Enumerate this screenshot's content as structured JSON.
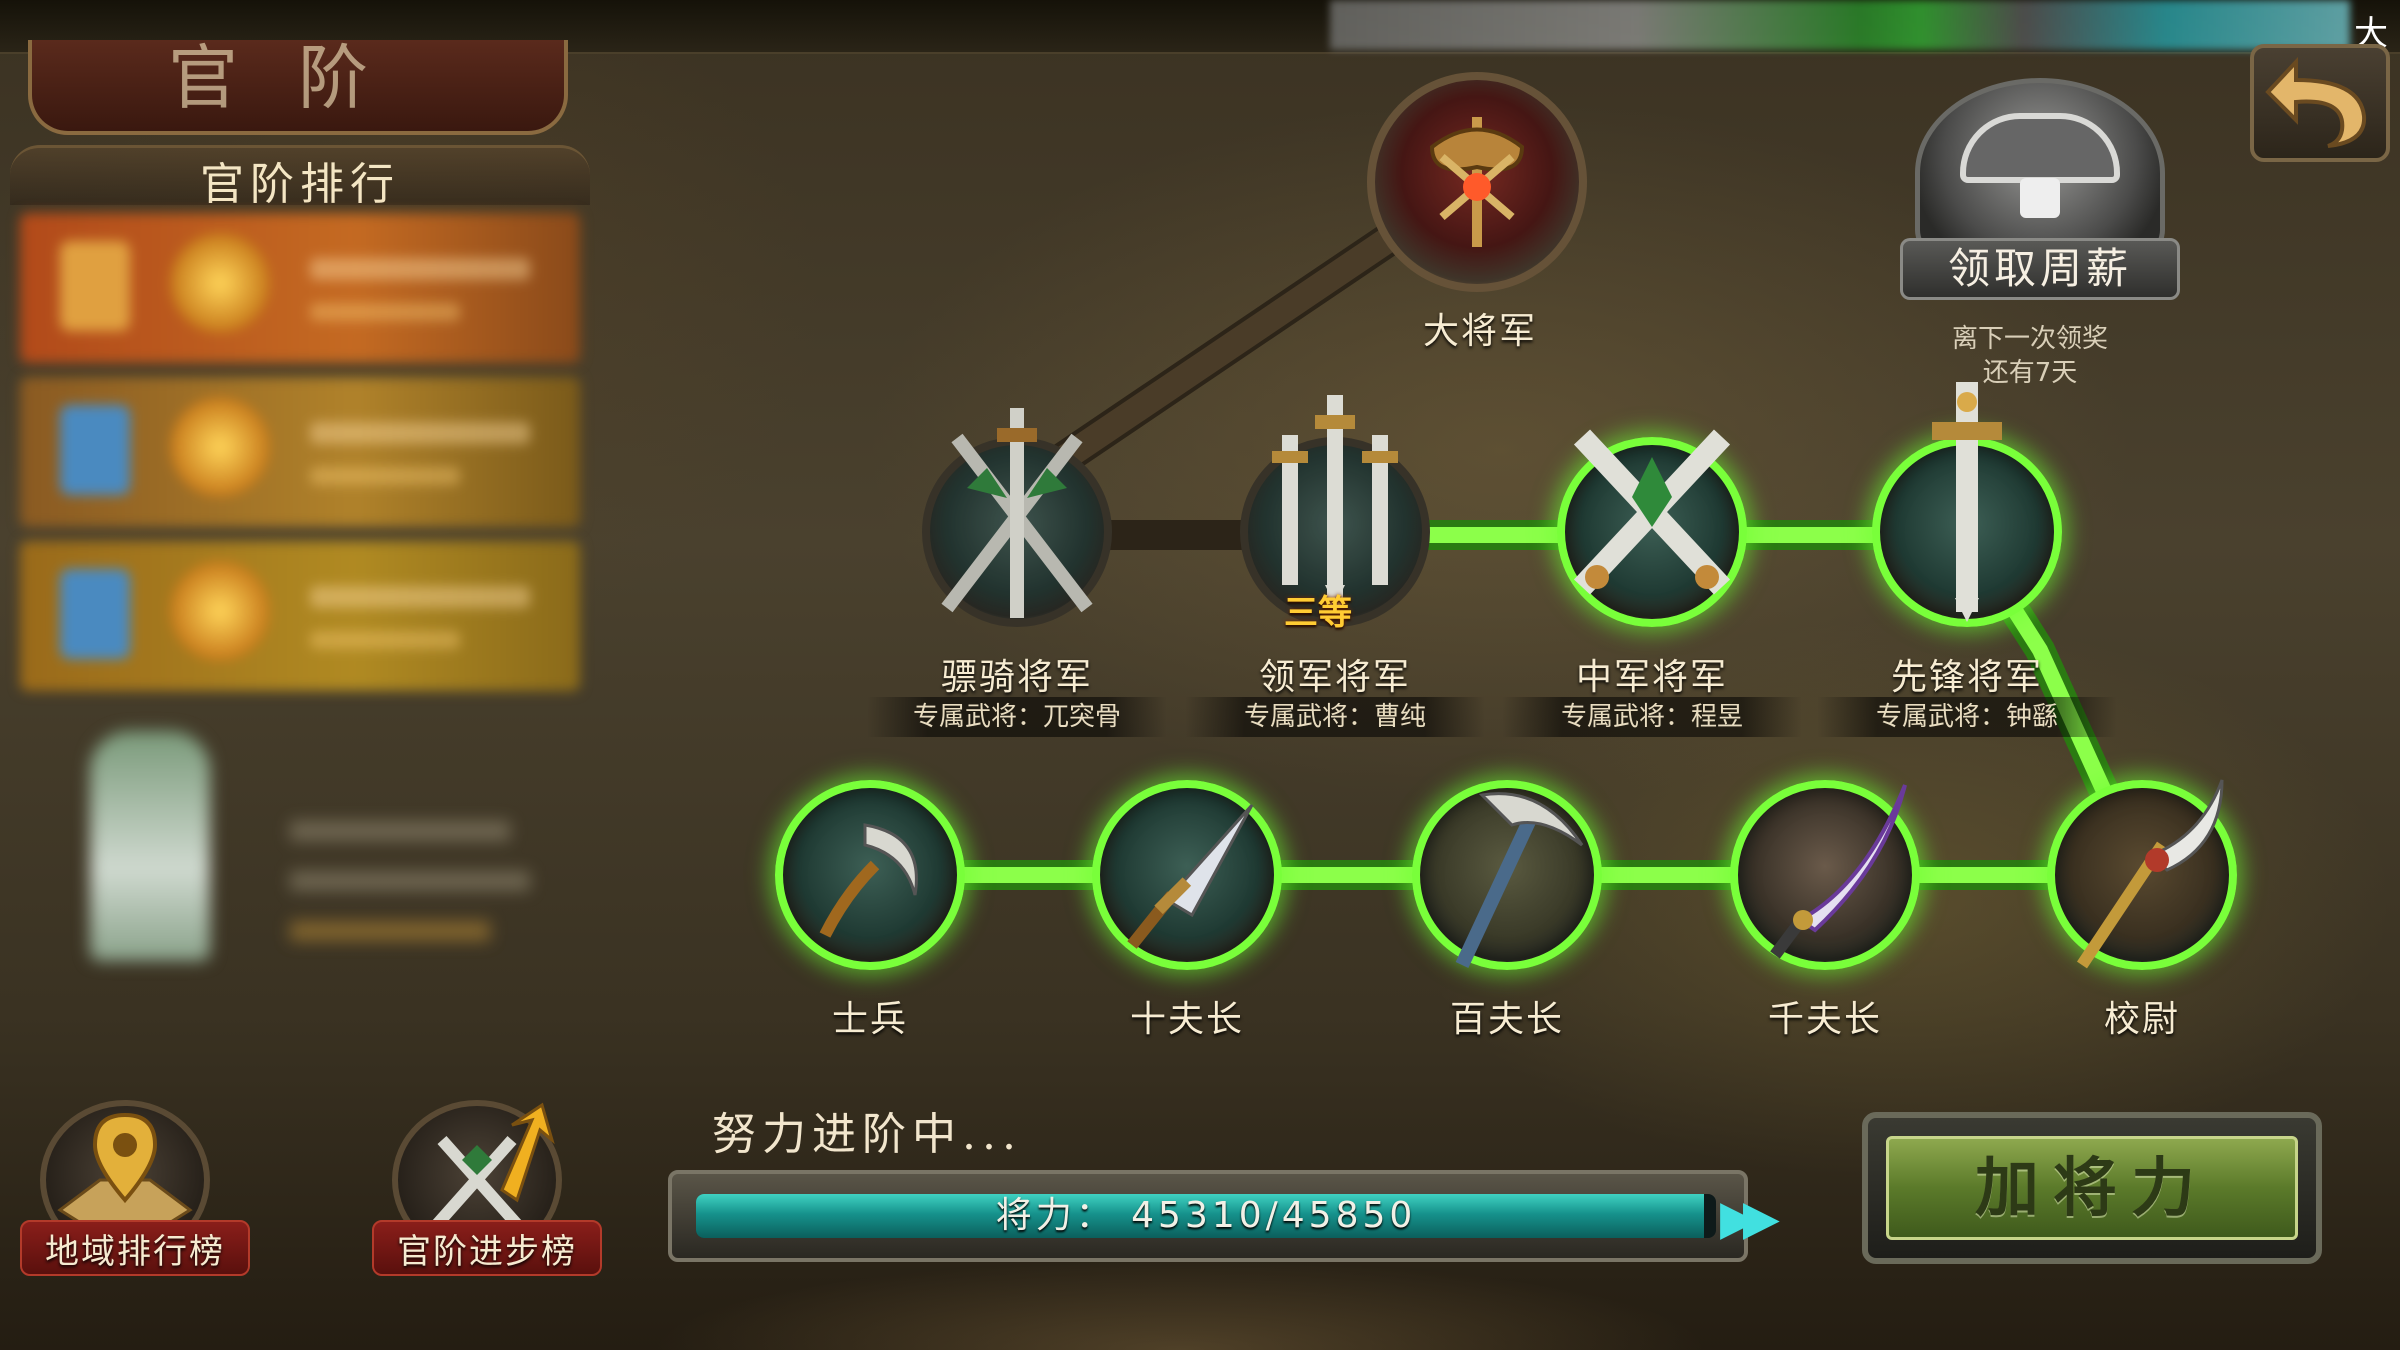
{
  "page": {
    "title": "官阶",
    "status_bar_char": "大"
  },
  "ranking": {
    "header": "官阶排行"
  },
  "reward": {
    "label": "领取周薪",
    "note_line1": "离下一次领奖",
    "note_line2": "还有7天"
  },
  "ranks": {
    "dajiangjun": {
      "label": "大将军"
    },
    "piaoqi": {
      "label": "骠骑将军",
      "general": "专属武将：兀突骨"
    },
    "lingjun": {
      "label": "领军将军",
      "general": "专属武将：曹纯",
      "grade": "三等"
    },
    "zhongjun": {
      "label": "中军将军",
      "general": "专属武将：程昱"
    },
    "xianfeng": {
      "label": "先锋将军",
      "general": "专属武将：钟繇"
    },
    "shibing": {
      "label": "士兵"
    },
    "shifuzhang": {
      "label": "十夫长"
    },
    "baifuzhang": {
      "label": "百夫长"
    },
    "qianfuzhang": {
      "label": "千夫长"
    },
    "xiaowei": {
      "label": "校尉"
    }
  },
  "bottom_buttons": {
    "region_rank": "地域排行榜",
    "rank_progress": "官阶进步榜"
  },
  "progress": {
    "caption": "努力进阶中...",
    "text": "将力： 45310/45850",
    "current": 45310,
    "max": 45850
  },
  "boost_button": {
    "label": "加将力"
  },
  "colors": {
    "active_glow": "#79ff3a",
    "progress_fill": "#16928c",
    "boost_button": "#5b7a2a"
  },
  "icons": {
    "back": "undo-arrow-icon",
    "reward": "treasure-chest-icon",
    "region_rank": "map-pin-icon",
    "rank_progress": "crossed-swords-arrow-icon"
  }
}
